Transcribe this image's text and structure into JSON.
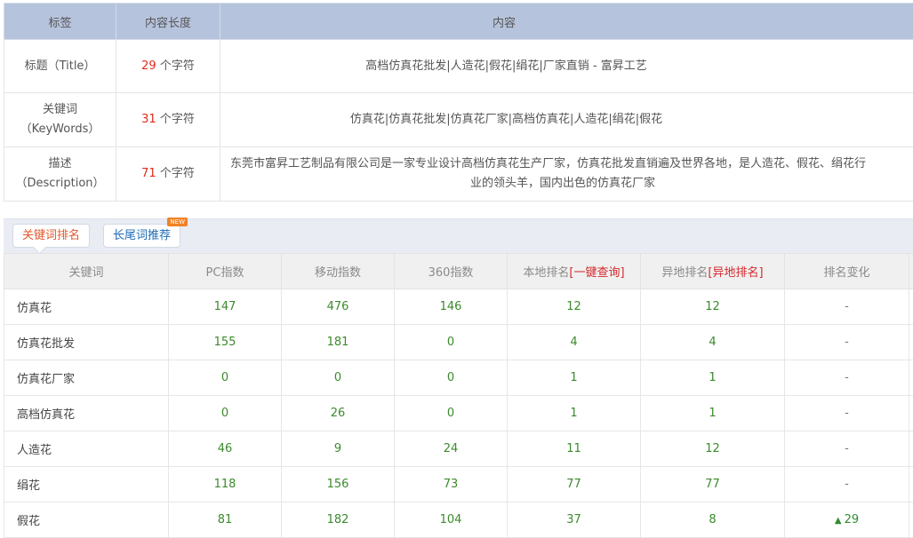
{
  "meta_table": {
    "headers": [
      "标签",
      "内容长度",
      "内容"
    ],
    "rows": [
      {
        "label_lines": [
          "标题（Title）"
        ],
        "count": "29",
        "unit": "个字符",
        "content_lines": [
          "高档仿真花批发|人造花|假花|绢花|厂家直销 - 富昇工艺"
        ]
      },
      {
        "label_lines": [
          "关键词",
          "（KeyWords）"
        ],
        "count": "31",
        "unit": "个字符",
        "content_lines": [
          "仿真花|仿真花批发|仿真花厂家|高档仿真花|人造花|绢花|假花"
        ]
      },
      {
        "label_lines": [
          "描述",
          "（Description）"
        ],
        "count": "71",
        "unit": "个字符",
        "content_lines": [
          "东莞市富昇工艺制品有限公司是一家专业设计高档仿真花生产厂家，仿真花批发直销遍及世界各地，是人造花、假花、绢花行",
          "业的领头羊，国内出色的仿真花厂家"
        ]
      }
    ]
  },
  "tabs": {
    "keyword_rank": "关键词排名",
    "long_tail": "长尾词推荐",
    "new_badge": "NEW"
  },
  "rank_table": {
    "headers": {
      "keyword": "关键词",
      "pc": "PC指数",
      "mobile": "移动指数",
      "s360": "360指数",
      "local_prefix": "本地排名",
      "local_link": "[一键查询]",
      "remote_prefix": "异地排名",
      "remote_link": "[异地排名]",
      "change": "排名变化"
    },
    "rows": [
      {
        "keyword": "仿真花",
        "pc": "147",
        "mobile": "476",
        "s360": "146",
        "local": "12",
        "remote": "12",
        "change": "-"
      },
      {
        "keyword": "仿真花批发",
        "pc": "155",
        "mobile": "181",
        "s360": "0",
        "local": "4",
        "remote": "4",
        "change": "-"
      },
      {
        "keyword": "仿真花厂家",
        "pc": "0",
        "mobile": "0",
        "s360": "0",
        "local": "1",
        "remote": "1",
        "change": "-"
      },
      {
        "keyword": "高档仿真花",
        "pc": "0",
        "mobile": "26",
        "s360": "0",
        "local": "1",
        "remote": "1",
        "change": "-"
      },
      {
        "keyword": "人造花",
        "pc": "46",
        "mobile": "9",
        "s360": "24",
        "local": "11",
        "remote": "12",
        "change": "-"
      },
      {
        "keyword": "绢花",
        "pc": "118",
        "mobile": "156",
        "s360": "73",
        "local": "77",
        "remote": "77",
        "change": "-"
      },
      {
        "keyword": "假花",
        "pc": "81",
        "mobile": "182",
        "s360": "104",
        "local": "37",
        "remote": "8",
        "change": "29",
        "change_icon": "arrow-up-icon"
      }
    ]
  },
  "colors": {
    "header_blue": "#b6c3dd",
    "count_red": "#e02b1c",
    "value_green": "#3b8a2c",
    "tab_active": "#e4572a",
    "tab_link": "#1e6bb5",
    "badge_orange": "#f18224"
  }
}
